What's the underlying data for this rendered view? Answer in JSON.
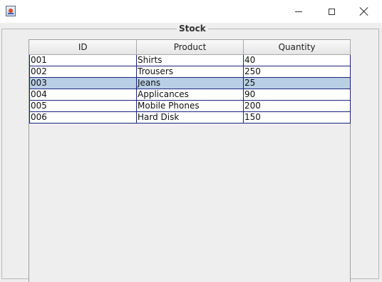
{
  "window": {
    "icon": "java-coffee-icon"
  },
  "panel": {
    "title": "Stock"
  },
  "table": {
    "columns": [
      "ID",
      "Product",
      "Quantity"
    ],
    "rows": [
      [
        "001",
        "Shirts",
        "40"
      ],
      [
        "002",
        "Trousers",
        "250"
      ],
      [
        "003",
        "Jeans",
        "25"
      ],
      [
        "004",
        "Applicances",
        "90"
      ],
      [
        "005",
        "Mobile Phones",
        "200"
      ],
      [
        "006",
        "Hard Disk",
        "150"
      ]
    ],
    "selected_row_index": 2
  },
  "colors": {
    "selection": "#b8cfe5",
    "grid": "#1a237e",
    "panel_background": "#eeeeee"
  }
}
